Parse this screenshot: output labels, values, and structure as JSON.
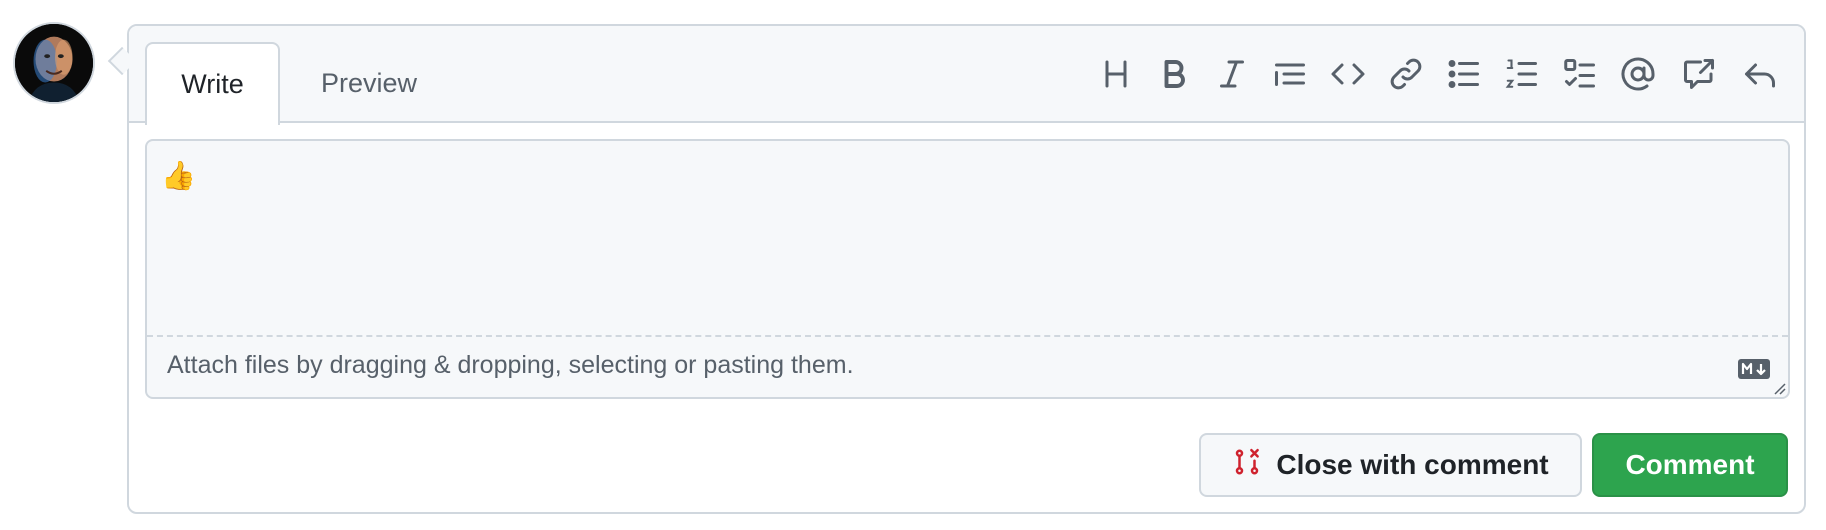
{
  "avatar": {
    "alt": "User avatar"
  },
  "tabs": [
    {
      "label": "Write",
      "active": true
    },
    {
      "label": "Preview",
      "active": false
    }
  ],
  "toolbar": {
    "icons": [
      "heading-icon",
      "bold-icon",
      "italic-icon",
      "quote-icon",
      "code-icon",
      "link-icon",
      "bulleted-list-icon",
      "numbered-list-icon",
      "task-list-icon",
      "mention-icon",
      "cross-reference-icon",
      "reply-icon"
    ]
  },
  "editor": {
    "value": "👍",
    "attach_hint": "Attach files by dragging & dropping, selecting or pasting them."
  },
  "buttons": {
    "close_with_comment": "Close with comment",
    "comment": "Comment"
  },
  "colors": {
    "primary_button": "#2da44e",
    "close_icon": "#cf222e",
    "border": "#d0d7de",
    "muted_text": "#57606a"
  }
}
